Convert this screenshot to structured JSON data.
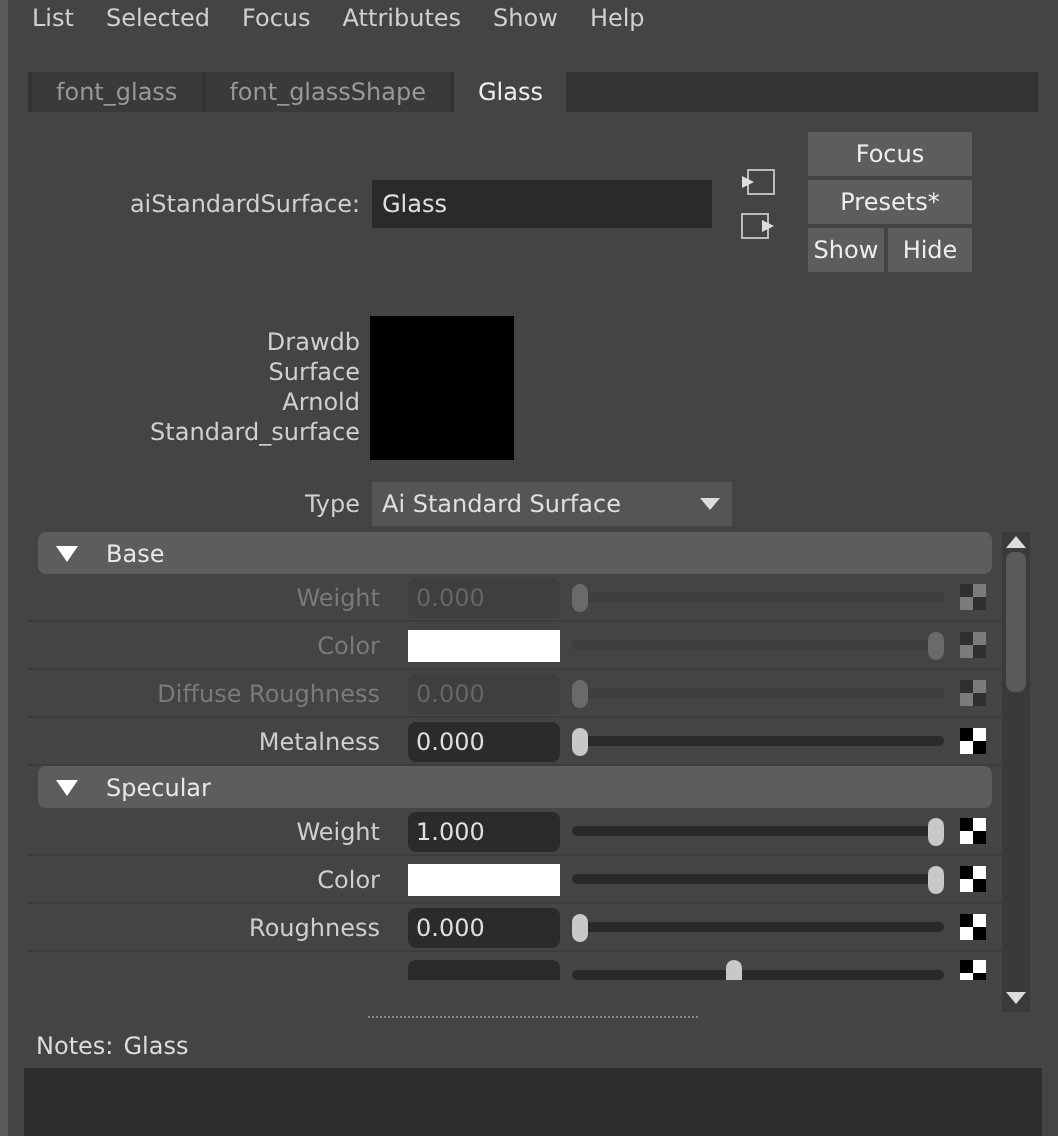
{
  "menu": [
    "List",
    "Selected",
    "Focus",
    "Attributes",
    "Show",
    "Help"
  ],
  "tabs": [
    {
      "label": "font_glass",
      "selected": false
    },
    {
      "label": "font_glassShape",
      "selected": false
    },
    {
      "label": "Glass",
      "selected": true
    }
  ],
  "node": {
    "label": "aiStandardSurface:",
    "value": "Glass"
  },
  "buttons": {
    "focus": "Focus",
    "presets": "Presets*",
    "show": "Show",
    "hide": "Hide"
  },
  "swatch_labels": [
    "Drawdb",
    "Surface",
    "Arnold",
    "Standard_surface"
  ],
  "type": {
    "label": "Type",
    "value": "Ai Standard Surface"
  },
  "sections": [
    {
      "title": "Base",
      "expanded": true,
      "rows": [
        {
          "kind": "slider",
          "label": "Weight",
          "value": "0.000",
          "level": 0,
          "disabled": true
        },
        {
          "kind": "color",
          "label": "Color",
          "level": 1,
          "disabled": true
        },
        {
          "kind": "slider",
          "label": "Diffuse Roughness",
          "value": "0.000",
          "level": 0,
          "disabled": true
        },
        {
          "kind": "slider",
          "label": "Metalness",
          "value": "0.000",
          "level": 0,
          "disabled": false
        }
      ]
    },
    {
      "title": "Specular",
      "expanded": true,
      "rows": [
        {
          "kind": "slider",
          "label": "Weight",
          "value": "1.000",
          "level": 1,
          "disabled": false
        },
        {
          "kind": "color",
          "label": "Color",
          "level": 1,
          "disabled": false
        },
        {
          "kind": "slider",
          "label": "Roughness",
          "value": "0.000",
          "level": 0,
          "disabled": false
        },
        {
          "kind": "partial",
          "level": 0.43,
          "disabled": false
        }
      ]
    }
  ],
  "notes": {
    "label": "Notes:",
    "value": "Glass"
  }
}
